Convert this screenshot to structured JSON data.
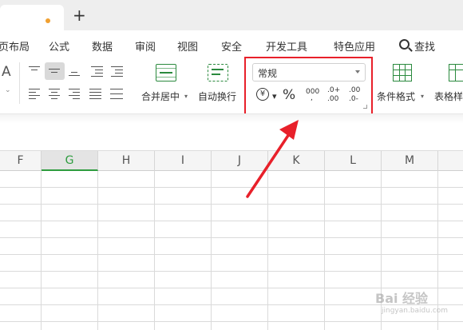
{
  "tabs": {
    "add_label": "+"
  },
  "menu": {
    "items": [
      "页面布局",
      "公式",
      "数据",
      "审阅",
      "视图",
      "安全",
      "开发工具",
      "特色应用"
    ],
    "first_visible": "页布局",
    "search_label": "查找"
  },
  "ribbon": {
    "merge_label": "合并居中",
    "wrap_label": "自动换行",
    "number_format_value": "常规",
    "currency_symbol": "¥",
    "percent_symbol": "%",
    "thousands_symbol": "000",
    "increase_decimal_top": ".0+",
    "increase_decimal_bottom": ".00",
    "decrease_decimal_top": ".00",
    "decrease_decimal_bottom": ".0-",
    "conditional_format_label": "条件格式",
    "table_style_label": "表格样",
    "partial_left_label": "A"
  },
  "sheet": {
    "columns": [
      "F",
      "G",
      "H",
      "I",
      "J",
      "K",
      "L",
      "M"
    ],
    "active_column": "G"
  },
  "colors": {
    "highlight": "#e8202a",
    "accent_green": "#2e9c3f",
    "tab_dot": "#f0a030"
  },
  "watermark": {
    "main": "Bai 经验",
    "sub": "jingyan.baidu.com"
  }
}
